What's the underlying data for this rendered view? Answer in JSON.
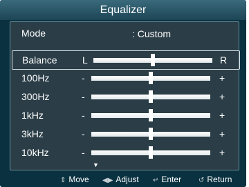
{
  "title": "Equalizer",
  "mode": {
    "label": "Mode",
    "value": ": Custom"
  },
  "bands": [
    {
      "label": "Balance",
      "left": "L",
      "right": "R",
      "level": 0.5,
      "selected": true
    },
    {
      "label": "100Hz",
      "left": "-",
      "right": "+",
      "level": 0.5
    },
    {
      "label": "300Hz",
      "left": "-",
      "right": "+",
      "level": 0.5
    },
    {
      "label": "1kHz",
      "left": "-",
      "right": "+",
      "level": 0.5
    },
    {
      "label": "3kHz",
      "left": "-",
      "right": "+",
      "level": 0.5
    },
    {
      "label": "10kHz",
      "left": "-",
      "right": "+",
      "level": 0.5
    }
  ],
  "footer": {
    "move": {
      "icon": "up-down-arrows-icon",
      "label": "Move"
    },
    "adjust": {
      "icon": "left-right-arrows-icon",
      "label": "Adjust"
    },
    "enter": {
      "icon": "enter-icon",
      "label": "Enter"
    },
    "return": {
      "icon": "return-icon",
      "label": "Return"
    }
  },
  "colors": {
    "background": "#0a3140",
    "panel": "#2b3e47",
    "text": "#ffffff"
  }
}
